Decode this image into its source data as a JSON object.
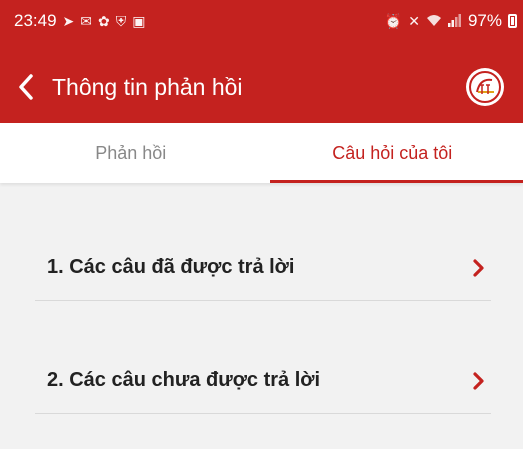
{
  "status_bar": {
    "time": "23:49",
    "battery": "97%",
    "left_icons": [
      "navigation-icon",
      "mail-icon",
      "app-icon",
      "shield-icon",
      "image-icon"
    ],
    "right_icons": [
      "alarm-icon",
      "mute-icon",
      "wifi-icon",
      "signal-icon"
    ]
  },
  "header": {
    "title": "Thông tin phản hồi",
    "back_icon": "chevron-left-icon",
    "logo_icon": "app-logo-icon"
  },
  "tabs": [
    {
      "label": "Phản hồi",
      "active": false
    },
    {
      "label": "Câu hỏi của tôi",
      "active": true
    }
  ],
  "list": {
    "items": [
      {
        "label": "1. Các câu đã được trả lời"
      },
      {
        "label": "2. Các câu chưa được trả lời"
      }
    ]
  },
  "colors": {
    "primary": "#c4221f",
    "background": "#f2f2f2",
    "tab_inactive": "#888888",
    "divider": "#d9d9d9"
  }
}
